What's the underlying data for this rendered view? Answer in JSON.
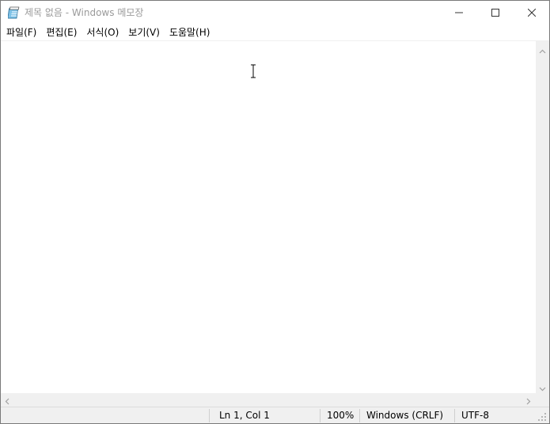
{
  "window": {
    "title": "제목 없음 - Windows 메모장",
    "icon": "notepad-icon"
  },
  "controls": {
    "minimize_icon": "minimize-icon",
    "maximize_icon": "maximize-icon",
    "close_icon": "close-icon"
  },
  "menu": {
    "items": [
      {
        "label": "파일(F)"
      },
      {
        "label": "편집(E)"
      },
      {
        "label": "서식(O)"
      },
      {
        "label": "보기(V)"
      },
      {
        "label": "도움말(H)"
      }
    ]
  },
  "editor": {
    "value": ""
  },
  "status": {
    "position": "Ln 1, Col 1",
    "zoom": "100%",
    "line_ending": "Windows (CRLF)",
    "encoding": "UTF-8"
  },
  "colors": {
    "title_text": "#9a9a9a",
    "chrome_gray": "#f0f0f0",
    "border": "#7a7a7a"
  }
}
